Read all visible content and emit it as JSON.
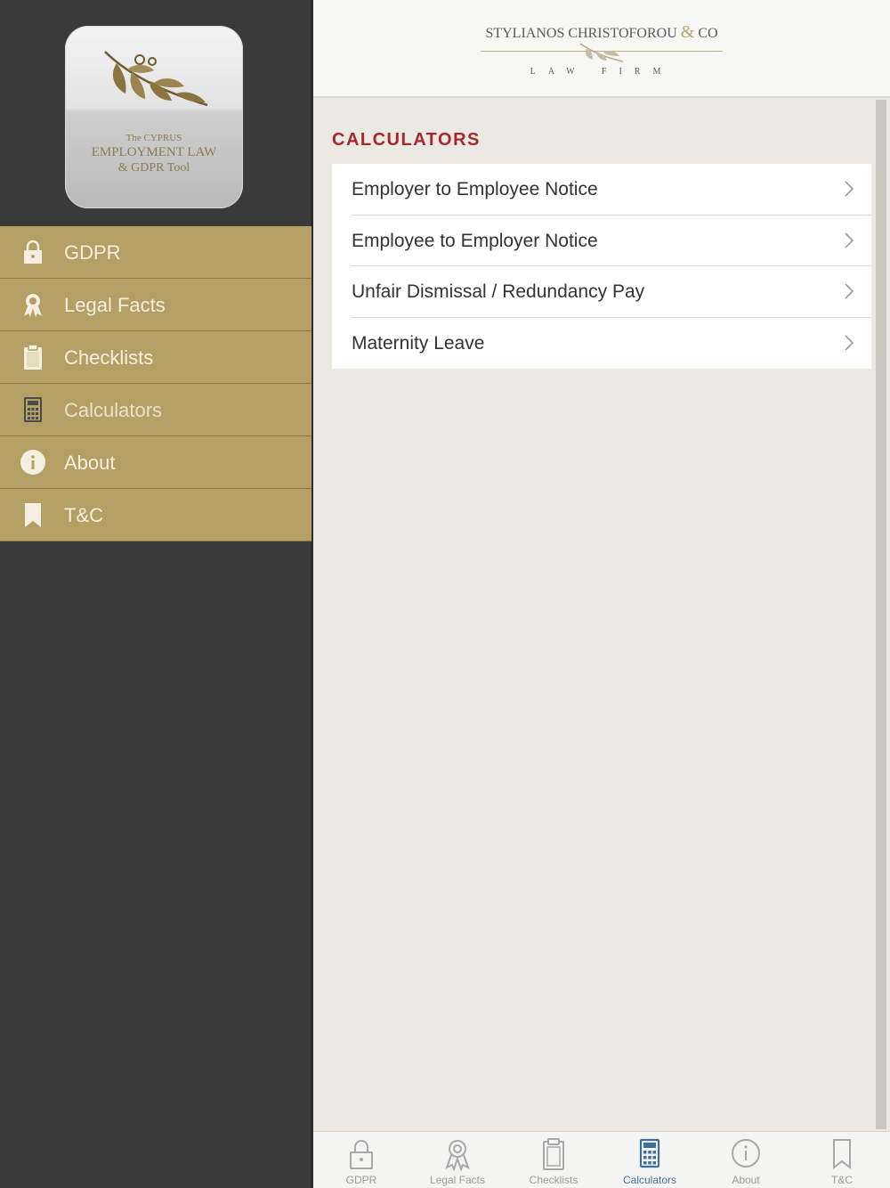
{
  "logo": {
    "line1": "The CYPRUS",
    "line2": "EMPLOYMENT LAW",
    "line3": "& GDPR Tool"
  },
  "sidebar": {
    "items": [
      {
        "label": "GDPR",
        "icon": "lock-icon"
      },
      {
        "label": "Legal Facts",
        "icon": "award-ribbon-icon"
      },
      {
        "label": "Checklists",
        "icon": "clipboard-icon"
      },
      {
        "label": "Calculators",
        "icon": "calculator-icon",
        "active": true
      },
      {
        "label": "About",
        "icon": "info-icon"
      },
      {
        "label": "T&C",
        "icon": "bookmark-icon"
      }
    ]
  },
  "header": {
    "firm_name": "STYLIANOS CHRISTOFOROU",
    "firm_amp": "&",
    "firm_co": "CO",
    "firm_sub": "LAW FIRM"
  },
  "main": {
    "section_title": "CALCULATORS",
    "items": [
      {
        "label": "Employer to Employee Notice"
      },
      {
        "label": "Employee to Employer Notice"
      },
      {
        "label": "Unfair Dismissal / Redundancy Pay"
      },
      {
        "label": "Maternity Leave"
      }
    ]
  },
  "tabbar": {
    "tabs": [
      {
        "label": "GDPR",
        "icon": "lock-icon"
      },
      {
        "label": "Legal Facts",
        "icon": "award-ribbon-icon"
      },
      {
        "label": "Checklists",
        "icon": "clipboard-icon"
      },
      {
        "label": "Calculators",
        "icon": "calculator-icon",
        "active": true
      },
      {
        "label": "About",
        "icon": "info-icon"
      },
      {
        "label": "T&C",
        "icon": "bookmark-icon"
      }
    ]
  },
  "colors": {
    "sidebar_bg": "#3a3a3a",
    "menu_gold": "#b4a064",
    "section_title": "#a5282c",
    "active_tab": "#3d6f9c",
    "content_bg": "#ebe9e3"
  }
}
